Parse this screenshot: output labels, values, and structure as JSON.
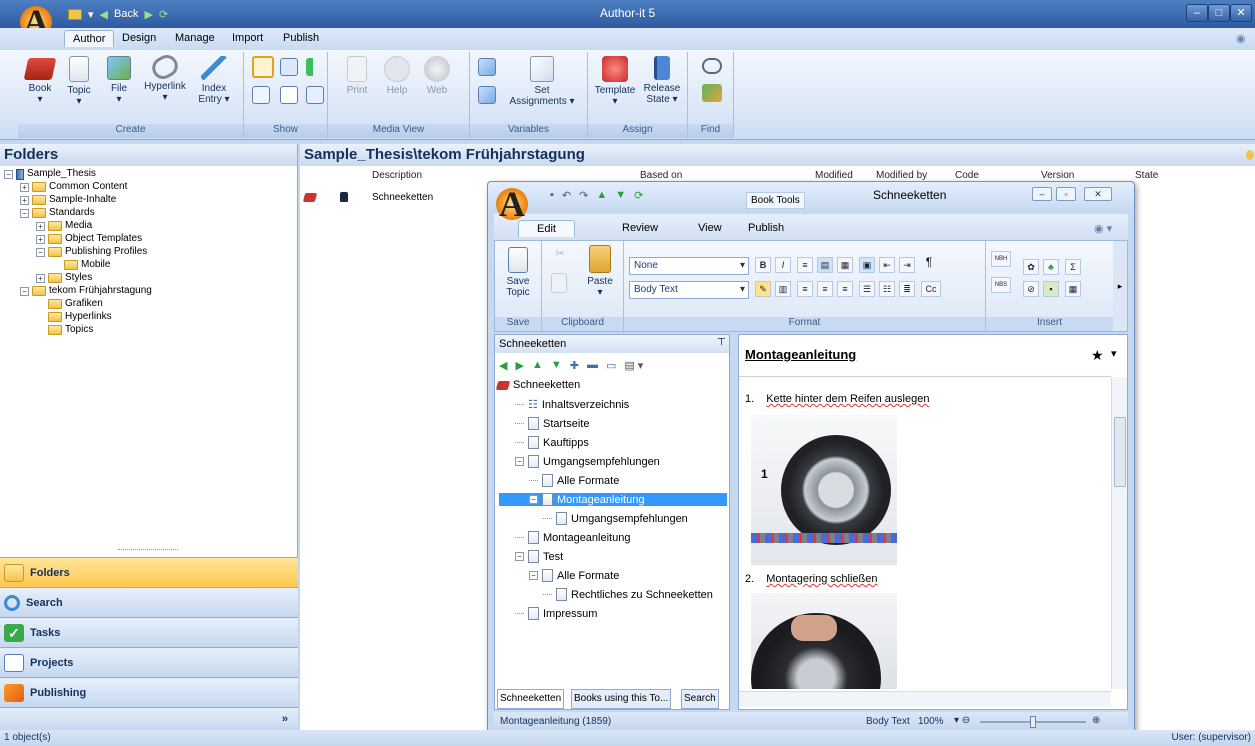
{
  "app": {
    "title": "Author-it 5",
    "back_label": "Back"
  },
  "ribbon_tabs": [
    "Author",
    "Design",
    "Manage",
    "Import",
    "Publish"
  ],
  "ribbon": {
    "create": {
      "label": "Create",
      "buttons": [
        "Book",
        "Topic",
        "File",
        "Hyperlink",
        "Index Entry ▾"
      ]
    },
    "show": {
      "label": "Show"
    },
    "media_view": {
      "label": "Media View",
      "buttons": [
        "Print",
        "Help",
        "Web"
      ]
    },
    "variables": {
      "label": "Variables",
      "set_label": "Set",
      "assignments_label": "Assignments ▾"
    },
    "assign": {
      "label": "Assign",
      "template_label": "Template",
      "release_label": "Release",
      "state_label": "State ▾"
    },
    "find": {
      "label": "Find"
    }
  },
  "folders_panel": {
    "title": "Folders",
    "tree": [
      {
        "label": "Sample_Thesis",
        "level": 0,
        "exp": "−"
      },
      {
        "label": "Common Content",
        "level": 1,
        "exp": "+"
      },
      {
        "label": "Sample-Inhalte",
        "level": 1,
        "exp": "+"
      },
      {
        "label": "Standards",
        "level": 1,
        "exp": "−"
      },
      {
        "label": "Media",
        "level": 2,
        "exp": "+"
      },
      {
        "label": "Object Templates",
        "level": 2,
        "exp": "+"
      },
      {
        "label": "Publishing Profiles",
        "level": 2,
        "exp": "−"
      },
      {
        "label": "Mobile",
        "level": 3,
        "exp": ""
      },
      {
        "label": "Styles",
        "level": 2,
        "exp": "+"
      },
      {
        "label": "tekom Frühjahrstagung",
        "level": 1,
        "exp": "−"
      },
      {
        "label": "Grafiken",
        "level": 2,
        "exp": ""
      },
      {
        "label": "Hyperlinks",
        "level": 2,
        "exp": ""
      },
      {
        "label": "Topics",
        "level": 2,
        "exp": ""
      }
    ],
    "nav_buttons": [
      "Folders",
      "Search",
      "Tasks",
      "Projects",
      "Publishing"
    ]
  },
  "main": {
    "path_title": "Sample_Thesis\\tekom Frühjahrstagung",
    "columns": [
      "Description",
      "Based on",
      "Modified",
      "Modified by",
      "Code",
      "Version",
      "State"
    ],
    "rows": [
      {
        "description": "Schneeketten"
      }
    ]
  },
  "topic_window": {
    "title": "Schneeketten",
    "context_tab": "Book Tools",
    "tabs": [
      "Edit",
      "Review",
      "View",
      "Publish"
    ],
    "ribbon": {
      "save_label": "Save",
      "topic_label": "Topic",
      "paste_label": "Paste",
      "group_save": "Save",
      "group_clipboard": "Clipboard",
      "group_format": "Format",
      "group_insert": "Insert",
      "style_combo": "None",
      "para_combo": "Body Text",
      "nbh": "NBH",
      "nbs": "NBS",
      "cc": "Cc"
    },
    "tree_pane_title": "Schneeketten",
    "tree": [
      {
        "label": "Schneeketten",
        "indent": 0,
        "type": "book",
        "exp": ""
      },
      {
        "label": "Inhaltsverzeichnis",
        "indent": 1,
        "type": "toc",
        "exp": ""
      },
      {
        "label": "Startseite",
        "indent": 1,
        "type": "doc",
        "exp": ""
      },
      {
        "label": "Kauftipps",
        "indent": 1,
        "type": "doc",
        "exp": ""
      },
      {
        "label": "Umgangsempfehlungen",
        "indent": 1,
        "type": "doc",
        "exp": "−"
      },
      {
        "label": "Alle Formate",
        "indent": 2,
        "type": "doc",
        "exp": ""
      },
      {
        "label": "Montageanleitung",
        "indent": 2,
        "type": "doc",
        "exp": "−",
        "selected": true
      },
      {
        "label": "Umgangsempfehlungen",
        "indent": 3,
        "type": "doc",
        "exp": ""
      },
      {
        "label": "Montageanleitung",
        "indent": 1,
        "type": "doc",
        "exp": ""
      },
      {
        "label": "Test",
        "indent": 1,
        "type": "doc",
        "exp": "−"
      },
      {
        "label": "Alle Formate",
        "indent": 2,
        "type": "doc",
        "exp": "−"
      },
      {
        "label": "Rechtliches zu Schneeketten",
        "indent": 3,
        "type": "doc",
        "exp": ""
      },
      {
        "label": "Impressum",
        "indent": 1,
        "type": "doc",
        "exp": ""
      }
    ],
    "bottom_tabs": [
      "Schneeketten",
      "Books using this To...",
      "Search"
    ],
    "editor": {
      "heading": "Montageanleitung",
      "star": "★",
      "steps": [
        {
          "num": "1.",
          "text": "Kette hinter dem Reifen auslegen"
        },
        {
          "num": "2.",
          "text": "Montagering schließen"
        }
      ],
      "figure_label": "1"
    },
    "status": {
      "left": "Montageanleitung (1859)",
      "style": "Body Text",
      "zoom": "100%"
    }
  },
  "statusbar": {
    "left": "1 object(s)",
    "right": "User: (supervisor)"
  },
  "colors": {
    "title_blue": "#2d5aa0",
    "selection": "#3399ff",
    "nav_active": "#ffc74c"
  }
}
